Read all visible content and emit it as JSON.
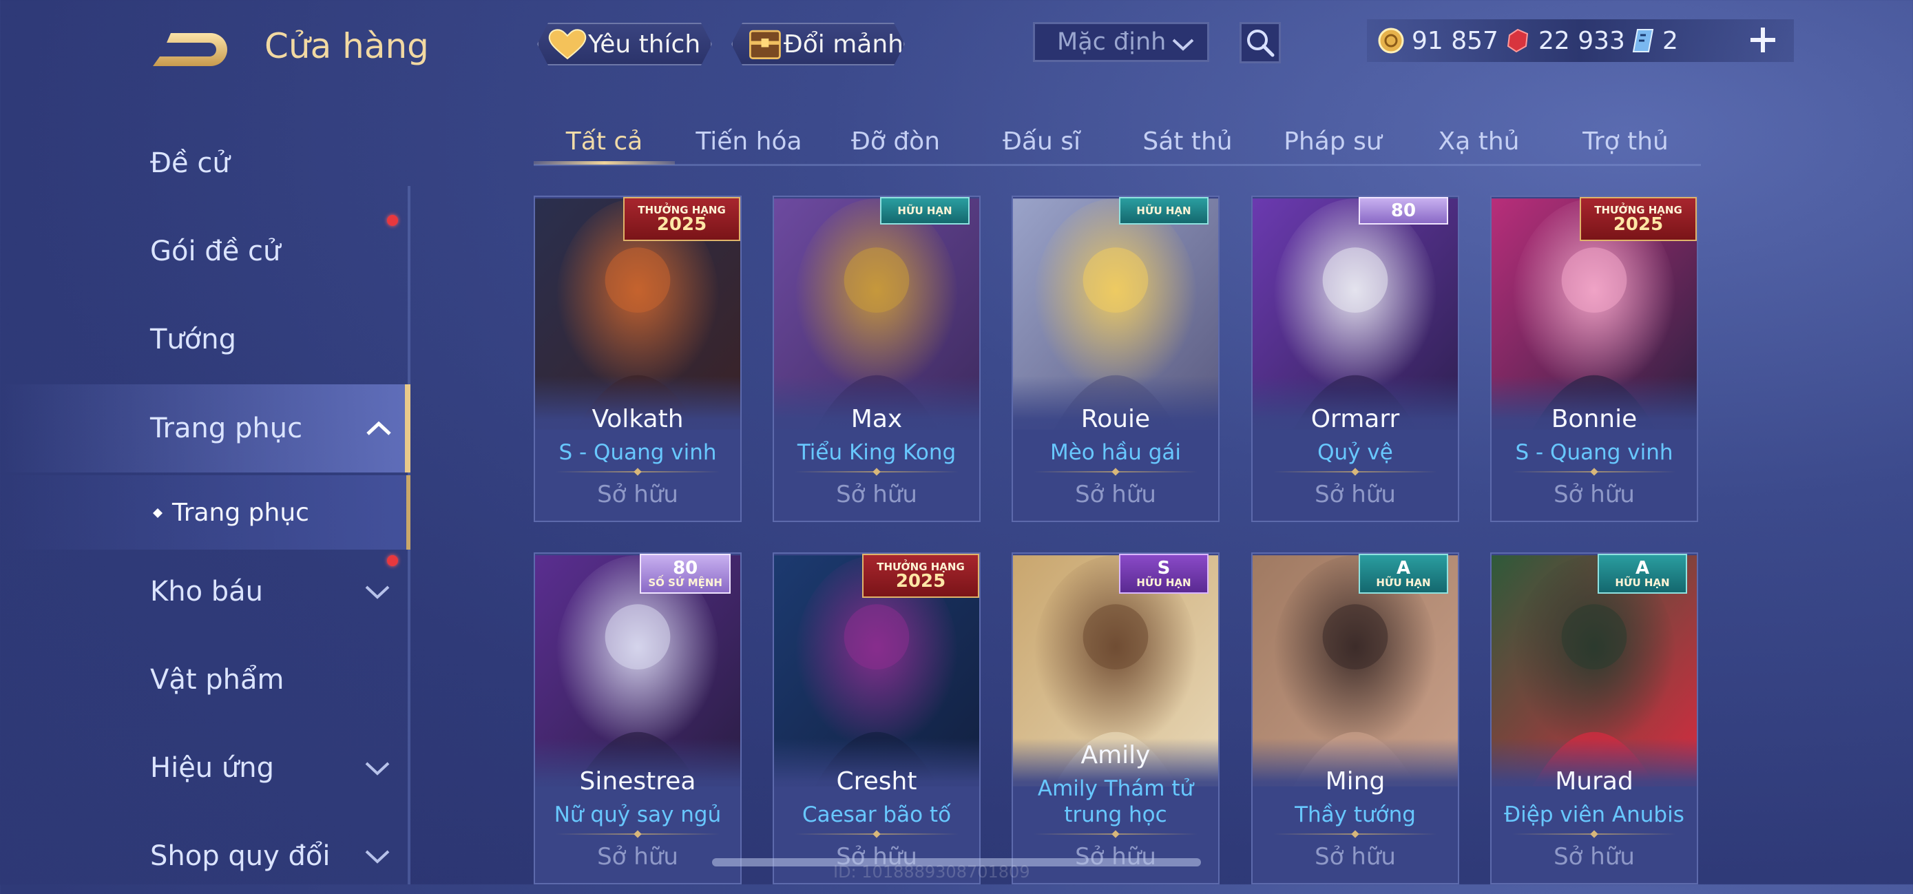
{
  "header": {
    "title": "Cửa hàng"
  },
  "top_bar": {
    "favorites_label": "Yêu thích",
    "exchange_label": "Đổi mảnh",
    "sort_dropdown": "Mặc định",
    "currencies": [
      {
        "icon": "gold-coin-icon",
        "value": "91 857"
      },
      {
        "icon": "red-gem-icon",
        "value": "22 933"
      },
      {
        "icon": "blue-voucher-icon",
        "value": "2"
      }
    ]
  },
  "sidebar": {
    "items": [
      {
        "label": "Đề cử",
        "has_chevron": false,
        "dot": false
      },
      {
        "label": "Gói đề cử",
        "has_chevron": false,
        "dot": true
      },
      {
        "label": "Tướng",
        "has_chevron": false,
        "dot": false
      },
      {
        "label": "Trang phục",
        "has_chevron": true,
        "expanded": true,
        "active": true
      },
      {
        "label": "Trang phục",
        "sub": true
      },
      {
        "label": "Kho báu",
        "has_chevron": true,
        "dot": true
      },
      {
        "label": "Vật phẩm",
        "has_chevron": false
      },
      {
        "label": "Hiệu ứng",
        "has_chevron": true
      },
      {
        "label": "Shop quy đổi",
        "has_chevron": true
      }
    ]
  },
  "tabs": [
    "Tất cả",
    "Tiến hóa",
    "Đỡ đòn",
    "Đấu sĩ",
    "Sát thủ",
    "Pháp sư",
    "Xạ thủ",
    "Trợ thủ"
  ],
  "active_tab": "Tất cả",
  "cards": [
    {
      "hero": "Volkath",
      "skin": "S - Quang vinh",
      "status": "Sở hữu",
      "badge_top": "THƯỞNG HẠNG",
      "badge_big": "2025",
      "badge_style": "red",
      "art_colors": [
        "#2a2f4e",
        "#c9652e",
        "#3a2226"
      ]
    },
    {
      "hero": "Max",
      "skin": "Tiểu King Kong",
      "status": "Sở hữu",
      "badge_top": "HỮU HẠN",
      "badge_big": "",
      "badge_style": "teal",
      "art_colors": [
        "#6d4aa0",
        "#c99a3a",
        "#3d2a5e"
      ]
    },
    {
      "hero": "Rouie",
      "skin": "Mèo hầu gái",
      "status": "Sở hữu",
      "badge_top": "HỮU HẠN",
      "badge_big": "",
      "badge_style": "teal",
      "art_colors": [
        "#9aa3c9",
        "#f0cc60",
        "#5a5a80"
      ]
    },
    {
      "hero": "Ormarr",
      "skin": "Quỷ vệ",
      "status": "Sở hữu",
      "badge_top": "",
      "badge_big": "80",
      "badge_style": "lav",
      "art_colors": [
        "#6b3ab0",
        "#e8e8f0",
        "#2e2050"
      ]
    },
    {
      "hero": "Bonnie",
      "skin": "S - Quang vinh",
      "status": "Sở hữu",
      "badge_top": "THƯỞNG HẠNG",
      "badge_big": "2025",
      "badge_style": "red",
      "art_colors": [
        "#b82e7a",
        "#f2a6c8",
        "#2a2040"
      ]
    },
    {
      "hero": "Sinestrea",
      "skin": "Nữ quỷ say ngủ",
      "status": "Sở hữu",
      "badge_top": "SỐ SỨ MỆNH",
      "badge_big": "80",
      "badge_style": "lav",
      "art_colors": [
        "#5a2e90",
        "#d8d8ef",
        "#2a1e44"
      ]
    },
    {
      "hero": "Cresht",
      "skin": "Caesar bão tố",
      "status": "Sở hữu",
      "badge_top": "THƯỞNG HẠNG",
      "badge_big": "2025",
      "badge_style": "red",
      "art_colors": [
        "#1c3a70",
        "#8a2e8e",
        "#122040"
      ]
    },
    {
      "hero": "Amily",
      "skin": "Amily Thám tử trung học",
      "status": "Sở hữu",
      "badge_top": "HỮU HẠN",
      "badge_big": "S",
      "badge_style": "purple",
      "art_colors": [
        "#c9a66e",
        "#6e4a32",
        "#e8d8b8"
      ]
    },
    {
      "hero": "Ming",
      "skin": "Thầy tướng",
      "status": "Sở hữu",
      "badge_top": "HỮU HẠN",
      "badge_big": "A",
      "badge_style": "teal",
      "art_colors": [
        "#a07a62",
        "#3a2a28",
        "#c9a08a"
      ]
    },
    {
      "hero": "Murad",
      "skin": "Điệp viên Anubis",
      "status": "Sở hữu",
      "badge_top": "HỮU HẠN",
      "badge_big": "A",
      "badge_style": "teal",
      "art_colors": [
        "#2e5a3a",
        "#2a3a2e",
        "#d82a40"
      ]
    }
  ],
  "footer_watermark": "ID: 1018889308701809"
}
